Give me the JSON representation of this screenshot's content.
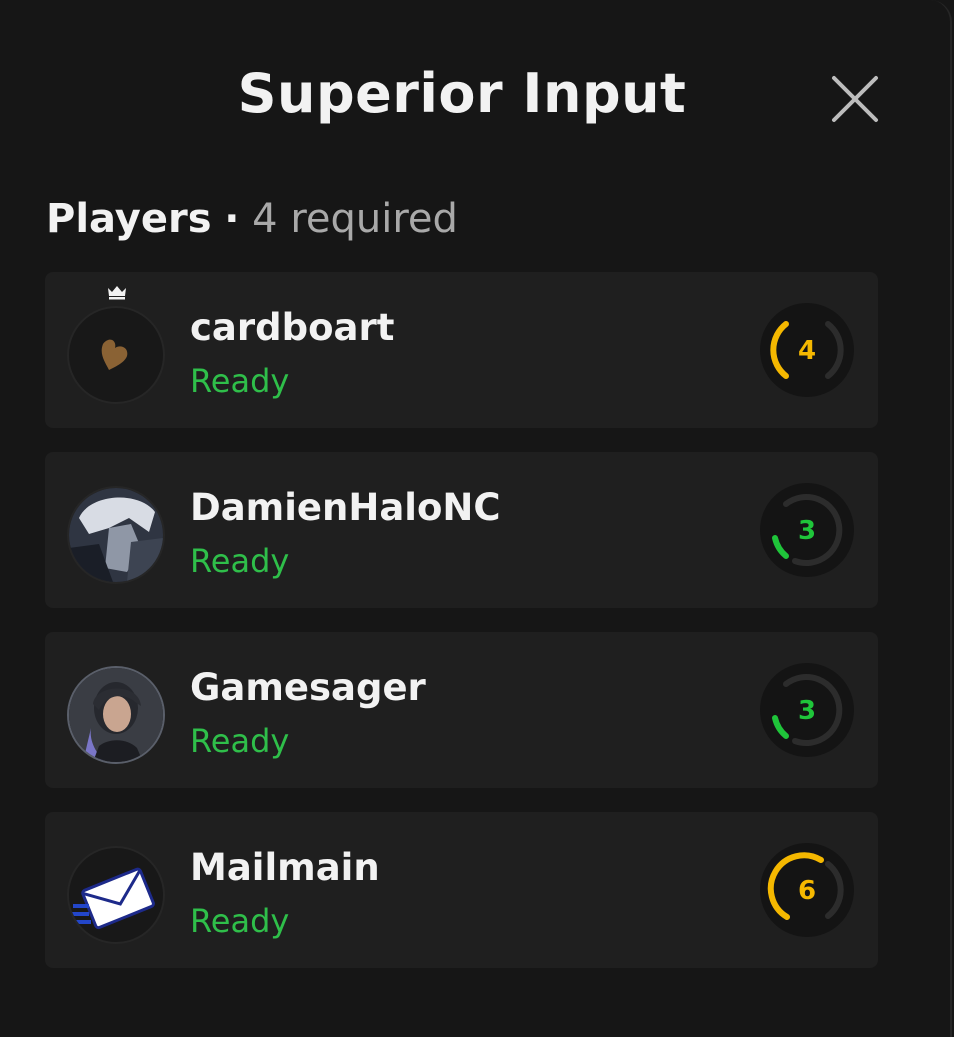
{
  "dialog": {
    "title": "Superior Input"
  },
  "players_section": {
    "heading": "Players",
    "separator": "·",
    "required_text": "4 required"
  },
  "players": [
    {
      "name": "cardboart",
      "status": "Ready",
      "level": "4",
      "is_host": true,
      "level_color": "#f5b800",
      "avatar_icon": "heart-icon"
    },
    {
      "name": "DamienHaloNC",
      "status": "Ready",
      "level": "3",
      "is_host": false,
      "level_color": "#1fc53a",
      "avatar_icon": "anime-portrait"
    },
    {
      "name": "Gamesager",
      "status": "Ready",
      "level": "3",
      "is_host": false,
      "level_color": "#1fc53a",
      "avatar_icon": "photo-portrait"
    },
    {
      "name": "Mailmain",
      "status": "Ready",
      "level": "6",
      "is_host": false,
      "level_color": "#f5b800",
      "avatar_icon": "envelope-icon"
    }
  ],
  "colors": {
    "background": "#161616",
    "card": "#1f1f1f",
    "ready_green": "#2fbf4a",
    "gauge_yellow": "#f5b800",
    "gauge_green": "#1fc53a"
  }
}
